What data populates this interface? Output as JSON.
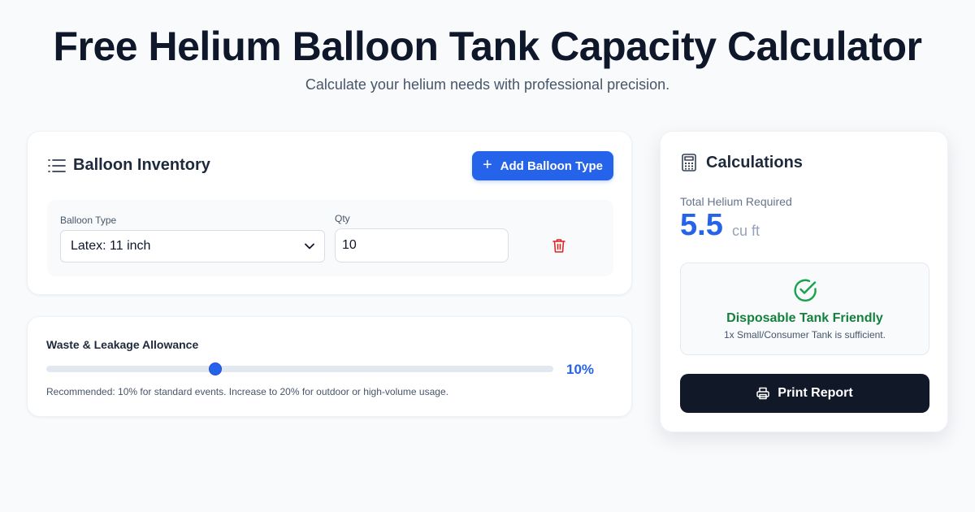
{
  "header": {
    "title": "Free Helium Balloon Tank Capacity Calculator",
    "subtitle": "Calculate your helium needs with professional precision."
  },
  "inventory": {
    "title": "Balloon Inventory",
    "add_button_label": "Add Balloon Type",
    "rows": [
      {
        "type_label": "Balloon Type",
        "type_value": "Latex: 11 inch",
        "qty_label": "Qty",
        "qty_value": "10"
      }
    ]
  },
  "waste": {
    "title": "Waste & Leakage Allowance",
    "value": 10,
    "display": "10%",
    "note": "Recommended: 10% for standard events. Increase to 20% for outdoor or high-volume usage."
  },
  "calculations": {
    "title": "Calculations",
    "total_label": "Total Helium Required",
    "total_value": "5.5",
    "total_unit": "cu ft",
    "status_title": "Disposable Tank Friendly",
    "status_note": "1x Small/Consumer Tank is sufficient.",
    "print_label": "Print Report"
  },
  "icons": {
    "list": "list-icon",
    "plus": "plus-icon",
    "chevron": "chevron-down-icon",
    "trash": "trash-icon",
    "calculator": "calculator-icon",
    "check": "check-circle-icon",
    "printer": "printer-icon"
  },
  "colors": {
    "accent": "#2563eb",
    "success": "#15803d",
    "danger": "#dc2626",
    "dark": "#111827"
  }
}
